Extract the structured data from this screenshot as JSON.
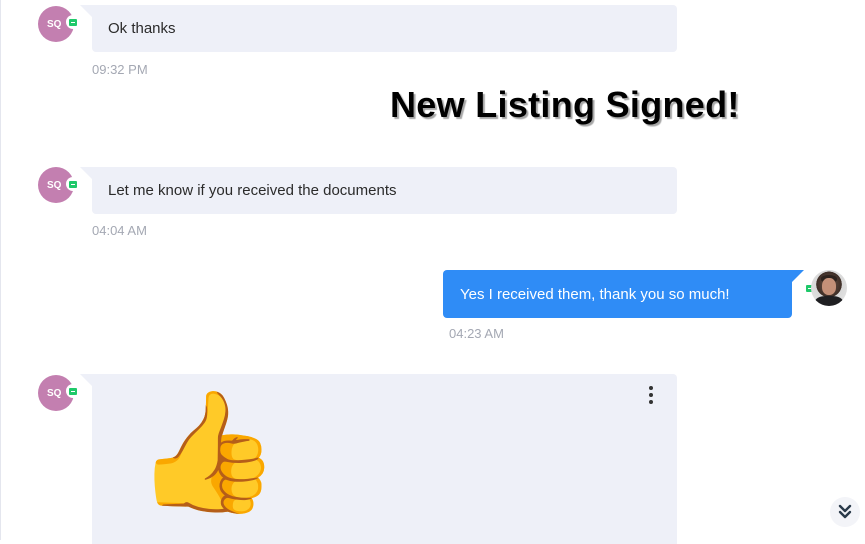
{
  "messages": [
    {
      "sender_initials": "SQ",
      "text": "Ok thanks",
      "time": "09:32 PM"
    },
    {
      "sender_initials": "SQ",
      "text": "Let me know if you received the documents",
      "time": "04:04 AM"
    },
    {
      "text": "Yes I received them, thank you so much!",
      "time": "04:23 AM"
    },
    {
      "sender_initials": "SQ",
      "emoji": "👍",
      "emoji_icon": "thumbs-up-icon"
    }
  ],
  "overlay": {
    "headline": "New Listing Signed!"
  },
  "colors": {
    "incoming_bubble": "#eef0f8",
    "outgoing_bubble": "#2f8cf6",
    "avatar": "#c37fb0",
    "status": "#1fc96a",
    "timestamp": "#a4a8b3"
  },
  "icons": {
    "status": "chat-status-icon",
    "menu": "more-vertical-icon",
    "scroll": "double-chevron-down-icon"
  }
}
